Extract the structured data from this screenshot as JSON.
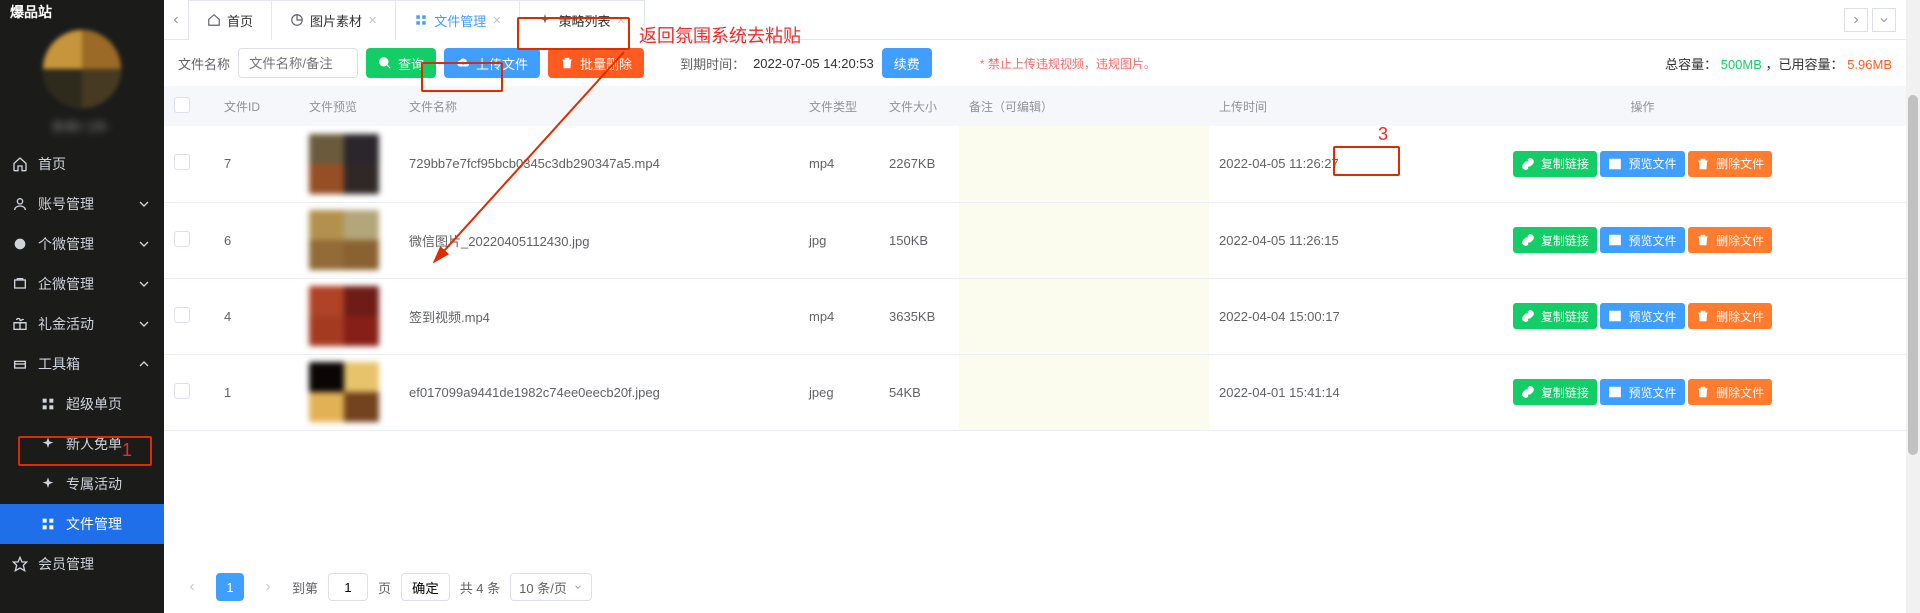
{
  "brand": "爆品站",
  "profile_name": "BiBi-18-  ",
  "sidebar": {
    "items": [
      {
        "label": "首页",
        "icon": "home"
      },
      {
        "label": "账号管理",
        "icon": "user",
        "chev": "down"
      },
      {
        "label": "个微管理",
        "icon": "wechat",
        "chev": "down"
      },
      {
        "label": "企微管理",
        "icon": "org",
        "chev": "down"
      },
      {
        "label": "礼金活动",
        "icon": "gift",
        "chev": "down"
      },
      {
        "label": "工具箱",
        "icon": "box",
        "chev": "up"
      }
    ],
    "sub": [
      {
        "label": "超级单页",
        "icon": "apps"
      },
      {
        "label": "新人免单",
        "icon": "spark"
      },
      {
        "label": "专属活动",
        "icon": "spark"
      },
      {
        "label": "文件管理",
        "icon": "apps",
        "active": true
      }
    ],
    "trailing": {
      "label": "会员管理",
      "icon": "star"
    }
  },
  "tabs": {
    "list": [
      {
        "label": "首页",
        "icon": "home",
        "closable": false
      },
      {
        "label": "图片素材",
        "icon": "pie",
        "closable": true
      },
      {
        "label": "文件管理",
        "icon": "apps",
        "closable": true,
        "active": true
      },
      {
        "label": "策略列表",
        "icon": "spark",
        "closable": true
      }
    ]
  },
  "toolbar": {
    "filename_label": "文件名称",
    "filename_placeholder": "文件名称/备注",
    "search": "查询",
    "upload": "上传文件",
    "batch_delete": "批量删除",
    "expire_label": "到期时间：",
    "expire_time": "2022-07-05 14:20:53",
    "renew": "续费",
    "warning": "* 禁止上传违规视频，违规图片。",
    "capacity_label_total": "总容量：",
    "capacity_total": "500MB",
    "capacity_label_used": "，已用容量：",
    "capacity_used": "5.96MB"
  },
  "table": {
    "headers": {
      "id": "文件ID",
      "preview": "文件预览",
      "name": "文件名称",
      "type": "文件类型",
      "size": "文件大小",
      "remark": "备注（可编辑）",
      "uploaded": "上传时间",
      "ops": "操作"
    },
    "rows": [
      {
        "id": "7",
        "name": "729bb7e7fcf95bcb0345c3db290347a5.mp4",
        "type": "mp4",
        "size": "2267KB",
        "remark": "",
        "uploaded": "2022-04-05 11:26:27",
        "thumb": [
          "#6a5b3c",
          "#2a262b",
          "#964e24",
          "#2f2827"
        ]
      },
      {
        "id": "6",
        "name": "微信图片_20220405112430.jpg",
        "type": "jpg",
        "size": "150KB",
        "remark": "",
        "uploaded": "2022-04-05 11:26:15",
        "thumb": [
          "#b3914d",
          "#b2a67a",
          "#916b38",
          "#8a6231"
        ]
      },
      {
        "id": "4",
        "name": "签到视频.mp4",
        "type": "mp4",
        "size": "3635KB",
        "remark": "",
        "uploaded": "2022-04-04 15:00:17",
        "thumb": [
          "#b04225",
          "#6e1c18",
          "#a43b21",
          "#861f17"
        ]
      },
      {
        "id": "1",
        "name": "ef017099a9441de1982c74ee0eecb20f.jpeg",
        "type": "jpeg",
        "size": "54KB",
        "remark": "",
        "uploaded": "2022-04-01 15:41:14",
        "thumb": [
          "#0b0605",
          "#e7c36b",
          "#e2b156",
          "#73421e"
        ]
      }
    ],
    "ops": {
      "copy": "复制链接",
      "preview": "预览文件",
      "delete": "删除文件"
    }
  },
  "pager": {
    "current": "1",
    "goto_prefix": "到第",
    "goto_value": "1",
    "goto_suffix": "页",
    "confirm": "确定",
    "total": "共 4 条",
    "pagesize": "10 条/页"
  },
  "annotations": {
    "text_top": "返回氛围系统去粘贴",
    "text_num1": "1",
    "text_num3": "3"
  }
}
